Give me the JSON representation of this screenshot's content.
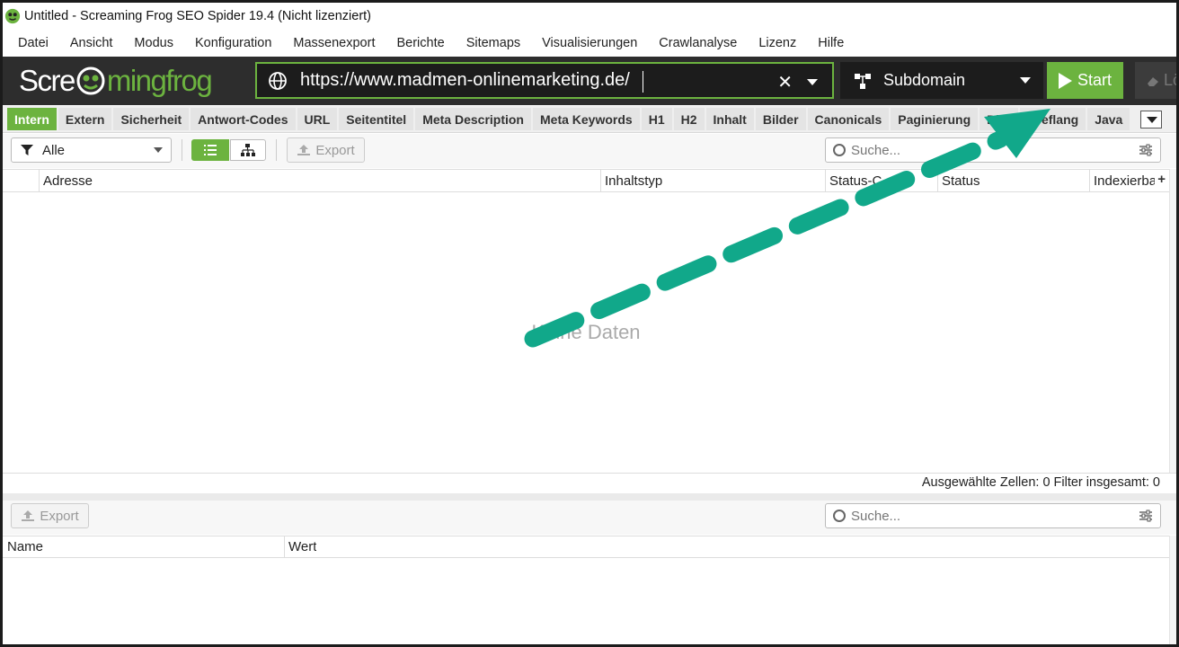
{
  "window": {
    "title": "Untitled - Screaming Frog SEO Spider 19.4 (Nicht lizenziert)"
  },
  "menu": [
    "Datei",
    "Ansicht",
    "Modus",
    "Konfiguration",
    "Massenexport",
    "Berichte",
    "Sitemaps",
    "Visualisierungen",
    "Crawlanalyse",
    "Lizenz",
    "Hilfe"
  ],
  "toolbar": {
    "logo_text_1": "Scre",
    "logo_text_2": "mingfrog",
    "url_value": "https://www.madmen-onlinemarketing.de/",
    "mode_label": "Subdomain",
    "start_label": "Start",
    "clear_label": "Lö"
  },
  "tabs": [
    "Intern",
    "Extern",
    "Sicherheit",
    "Antwort-Codes",
    "URL",
    "Seitentitel",
    "Meta Description",
    "Meta Keywords",
    "H1",
    "H2",
    "Inhalt",
    "Bilder",
    "Canonicals",
    "Paginierung",
    "Dire",
    "Hreflang",
    "Java"
  ],
  "active_tab": "Intern",
  "filter": {
    "selected": "Alle",
    "export_label": "Export",
    "search_placeholder": "Suche..."
  },
  "main_table": {
    "columns": [
      "Adresse",
      "Inhaltstyp",
      "Status-C",
      "Status",
      "Indexierba"
    ],
    "add_column_label": "+",
    "empty_text": "Keine Daten"
  },
  "status_bar": {
    "text": "Ausgewählte Zellen:  0  Filter insgesamt:  0"
  },
  "lower_panel": {
    "export_label": "Export",
    "search_placeholder": "Suche...",
    "columns": [
      "Name",
      "Wert"
    ]
  },
  "colors": {
    "brand_green": "#6cb33f",
    "toolbar_dark": "#2d2d2d",
    "annotation_teal": "#11a88a"
  },
  "icons": [
    "frog-app-icon",
    "globe-icon",
    "clear-icon",
    "subdomain-icon",
    "play-icon",
    "eraser-icon",
    "funnel-icon",
    "list-view-icon",
    "tree-view-icon",
    "export-icon",
    "search-icon",
    "settings-icon",
    "annotation-arrow"
  ]
}
